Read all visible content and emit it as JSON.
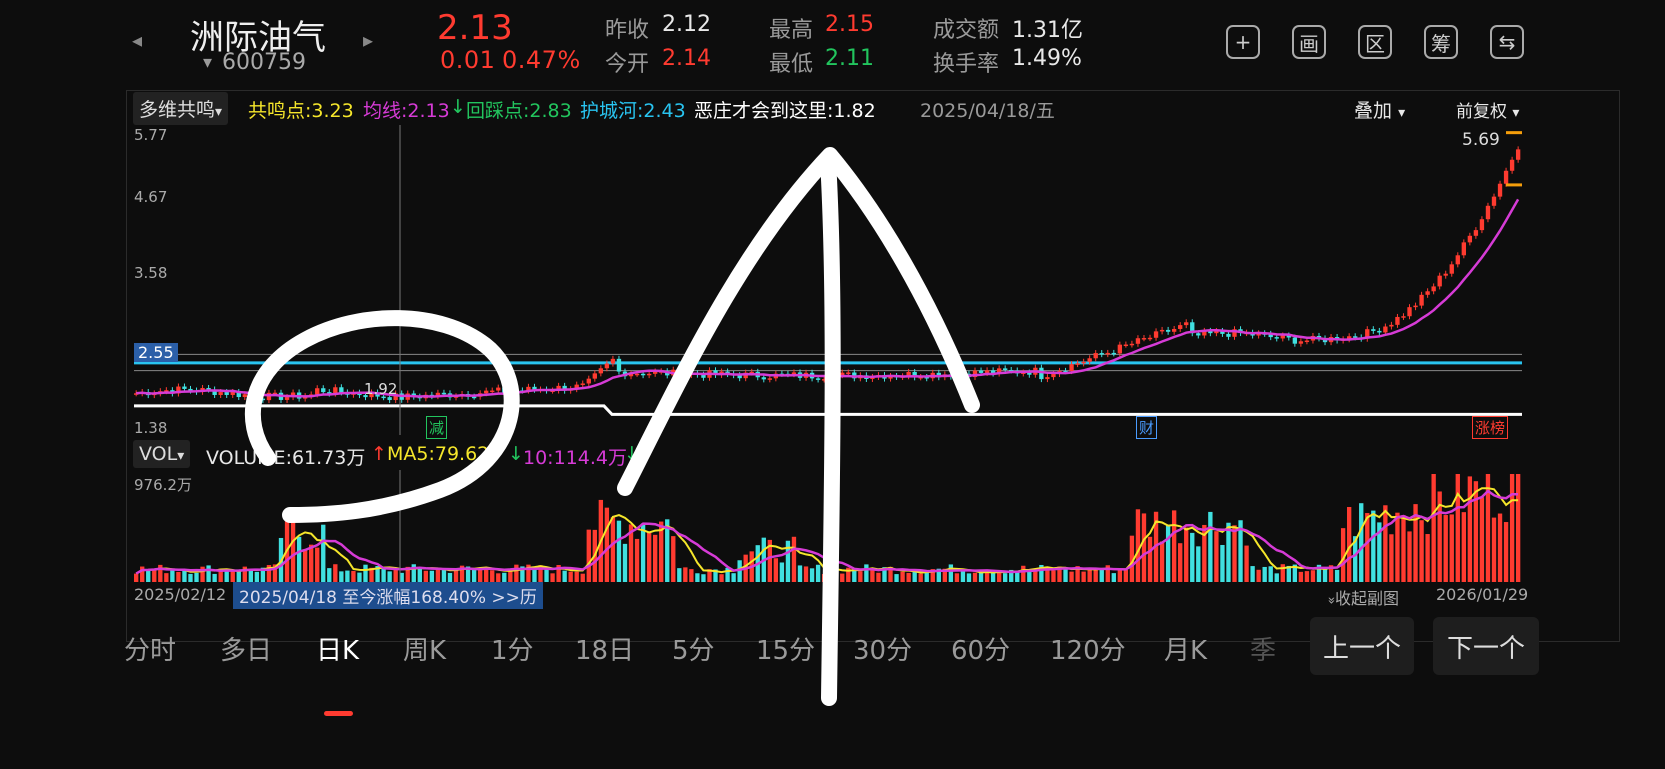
{
  "header": {
    "prev_arrow": "◂",
    "next_arrow": "▸",
    "stock_name": "洲际油气",
    "stock_code_caret": "▾",
    "stock_code": "600759",
    "price": "2.13",
    "change_abs": "0.01",
    "change_pct": "0.47%",
    "stats": {
      "prev_close_label": "昨收",
      "prev_close": "2.12",
      "open_label": "今开",
      "open": "2.14",
      "high_label": "最高",
      "high": "2.15",
      "low_label": "最低",
      "low": "2.11",
      "turnover_label": "成交额",
      "turnover": "1.31亿",
      "turnover_rate_label": "换手率",
      "turnover_rate": "1.49%"
    },
    "tools": [
      {
        "name": "add-icon",
        "glyph": "+"
      },
      {
        "name": "chart-view-icon",
        "glyph": "画"
      },
      {
        "name": "range-icon",
        "glyph": "区"
      },
      {
        "name": "chips-icon",
        "glyph": "筹"
      },
      {
        "name": "screen-switch-icon",
        "glyph": "⇆"
      }
    ]
  },
  "main_chart": {
    "indicator": "多维共鸣",
    "legend": {
      "gongming": "共鸣点:3.23",
      "junxian": "均线:2.13",
      "junxian_arrow": "↓",
      "huicai": "回踩点:2.83",
      "huchenghe": "护城河:2.43",
      "ezhuang": "恶庄才会到这里:1.82"
    },
    "cursor_date": "2025/04/18/五",
    "overlay_label": "叠加",
    "adjust_label": "前复权",
    "dropdown_caret": "▾",
    "y_ticks": [
      "5.77",
      "4.67",
      "3.58",
      "1.38"
    ],
    "level_chip": "2.55",
    "low_label": "1.92",
    "high_label": "5.69",
    "markers": {
      "jian": "减",
      "cai": "财",
      "zhangbang": "涨榜"
    }
  },
  "volume_chart": {
    "indicator": "VOL",
    "volume": "VOLUME:61.73万",
    "volume_arrow": "↑",
    "ma5": "MA5:79.62",
    "ma5_arrow": "↓",
    "ma10": "10:114.4万",
    "ma10_arrow": "↓",
    "y_max": "976.2万",
    "start_date": "2025/02/12",
    "end_date": "2026/01/29",
    "gain_text": "2025/04/18 至今涨幅168.40%  >>历",
    "collapse_label": "收起副图",
    "collapse_icon": "»"
  },
  "colors": {
    "up": "#ff3b30",
    "down": "#40e0e0",
    "ma_purple": "#d63bd6",
    "ma_yellow": "#f5e62b",
    "cyan_line": "#29c4f0",
    "white_line": "#ffffff"
  },
  "tabs": {
    "items": [
      "分时",
      "多日",
      "日K",
      "周K",
      "1分",
      "18日",
      "5分",
      "15分",
      "30分",
      "60分",
      "120分",
      "月K",
      "季"
    ],
    "active_index": 2,
    "prev": "上一个",
    "next": "下一个"
  }
}
